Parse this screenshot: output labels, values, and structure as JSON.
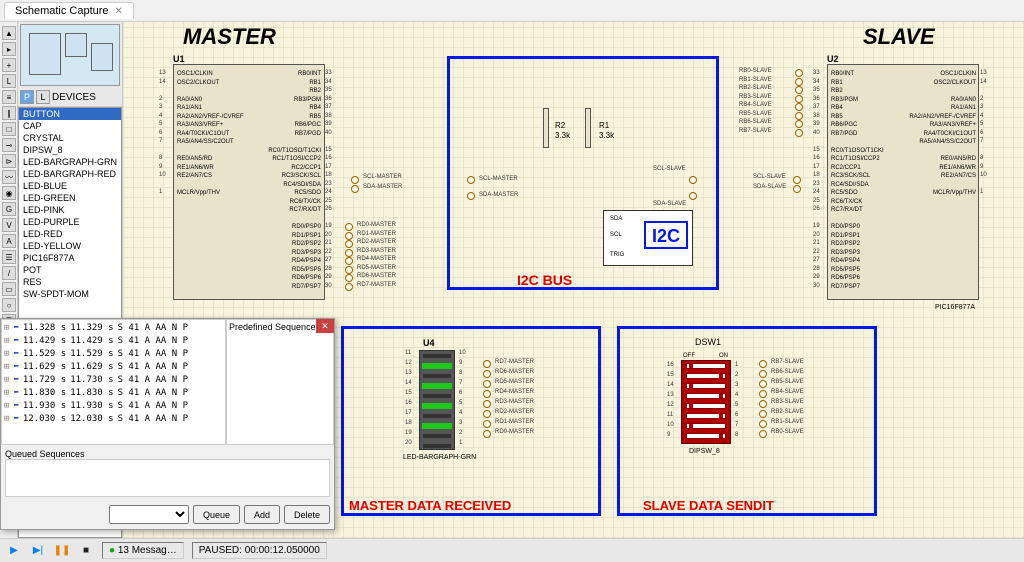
{
  "tab": {
    "title": "Schematic Capture",
    "close": "✕"
  },
  "devices": {
    "header": "DEVICES",
    "items": [
      "BUTTON",
      "CAP",
      "CRYSTAL",
      "DIPSW_8",
      "LED-BARGRAPH-GRN",
      "LED-BARGRAPH-RED",
      "LED-BLUE",
      "LED-GREEN",
      "LED-PINK",
      "LED-PURPLE",
      "LED-RED",
      "LED-YELLOW",
      "PIC16F877A",
      "POT",
      "RES",
      "SW-SPDT-MOM"
    ],
    "selected_index": 0
  },
  "titles": {
    "master": "MASTER",
    "slave": "SLAVE",
    "i2c_bus": "I2C BUS",
    "master_data": "MASTER DATA RECEIVED",
    "slave_data": "SLAVE DATA SENDIT"
  },
  "refs": {
    "u1": "U1",
    "u2": "U2",
    "u4": "U4",
    "dsw1": "DSW1",
    "r1": "R1",
    "r2": "R2",
    "r_val": "3.3k"
  },
  "i2c": {
    "label": "I2C",
    "sda": "SDA",
    "scl": "SCL",
    "trig": "TRIG"
  },
  "bus_labels": {
    "scl_master": "SCL-MASTER",
    "sda_master": "SDA-MASTER",
    "scl_slave": "SCL-SLAVE",
    "sda_slave": "SDA-SLAVE"
  },
  "u1_pins_left": [
    "OSC1/CLKIN",
    "OSC2/CLKOUT",
    "",
    "RA0/AN0",
    "RA1/AN1",
    "RA2/AN2/VREF-/CVREF",
    "RA3/AN3/VREF+",
    "RA4/T0CKI/C1OUT",
    "RA5/AN4/SS/C2OUT",
    "",
    "RE0/AN5/RD",
    "RE1/AN6/WR",
    "RE2/AN7/CS",
    "",
    "MCLR/Vpp/THV"
  ],
  "u1_nums_left": [
    "13",
    "14",
    "",
    "2",
    "3",
    "4",
    "5",
    "6",
    "7",
    "",
    "8",
    "9",
    "10",
    "",
    "1"
  ],
  "u1_pins_right": [
    "RB0/INT",
    "RB1",
    "RB2",
    "RB3/PGM",
    "RB4",
    "RB5",
    "RB6/PGC",
    "RB7/PGD",
    "",
    "RC0/T1OSO/T1CKI",
    "RC1/T1OSI/CCP2",
    "RC2/CCP1",
    "RC3/SCK/SCL",
    "RC4/SDI/SDA",
    "RC5/SDO",
    "RC6/TX/CK",
    "RC7/RX/DT",
    "",
    "RD0/PSP0",
    "RD1/PSP1",
    "RD2/PSP2",
    "RD3/PSP3",
    "RD4/PSP4",
    "RD5/PSP5",
    "RD6/PSP6",
    "RD7/PSP7"
  ],
  "u1_nums_right": [
    "33",
    "34",
    "35",
    "36",
    "37",
    "38",
    "39",
    "40",
    "",
    "15",
    "16",
    "17",
    "18",
    "23",
    "24",
    "25",
    "26",
    "",
    "19",
    "20",
    "21",
    "22",
    "27",
    "28",
    "29",
    "30"
  ],
  "u2_pins_left": [
    "RB0/INT",
    "RB1",
    "RB2",
    "RB3/PGM",
    "RB4",
    "RB5",
    "RB6/PGC",
    "RB7/PGD",
    "",
    "RC0/T1OSO/T1CKI",
    "RC1/T1OSI/CCP2",
    "RC2/CCP1",
    "RC3/SCK/SCL",
    "RC4/SDI/SDA",
    "RC5/SDO",
    "RC6/TX/CK",
    "RC7/RX/DT",
    "",
    "RD0/PSP0",
    "RD1/PSP1",
    "RD2/PSP2",
    "RD3/PSP3",
    "RD4/PSP4",
    "RD5/PSP5",
    "RD6/PSP6",
    "RD7/PSP7"
  ],
  "u2_nums_left": [
    "33",
    "34",
    "35",
    "36",
    "37",
    "38",
    "39",
    "40",
    "",
    "15",
    "16",
    "17",
    "18",
    "23",
    "24",
    "25",
    "26",
    "",
    "19",
    "20",
    "21",
    "22",
    "27",
    "28",
    "29",
    "30"
  ],
  "u2_pins_right": [
    "OSC1/CLKIN",
    "OSC2/CLKOUT",
    "",
    "RA0/AN0",
    "RA1/AN1",
    "RA2/AN2/VREF-/CVREF",
    "RA3/AN3/VREF+",
    "RA4/T0CKI/C1OUT",
    "RA5/AN4/SS/C2OUT",
    "",
    "RE0/AN5/RD",
    "RE1/AN6/WR",
    "RE2/AN7/CS",
    "",
    "MCLR/Vpp/THV"
  ],
  "u2_nums_right": [
    "13",
    "14",
    "",
    "2",
    "3",
    "4",
    "5",
    "6",
    "7",
    "",
    "8",
    "9",
    "10",
    "",
    "1"
  ],
  "u2_slave_probes": [
    "RB0-SLAVE",
    "RB1-SLAVE",
    "RB2-SLAVE",
    "RB3-SLAVE",
    "RB4-SLAVE",
    "RB5-SLAVE",
    "RB6-SLAVE",
    "RB7-SLAVE"
  ],
  "u1_master_probes": [
    "RD0-MASTER",
    "RD1-MASTER",
    "RD2-MASTER",
    "RD3-MASTER",
    "RD4-MASTER",
    "RD5-MASTER",
    "RD6-MASTER",
    "RD7-MASTER"
  ],
  "u4_nums_left": [
    "11",
    "12",
    "13",
    "14",
    "15",
    "16",
    "17",
    "18",
    "19",
    "20"
  ],
  "u4_nums_right": [
    "10",
    "9",
    "8",
    "7",
    "6",
    "5",
    "4",
    "3",
    "2",
    "1"
  ],
  "u4_right_probes": [
    "RD7-MASTER",
    "RD6-MASTER",
    "RD5-MASTER",
    "RD4-MASTER",
    "RD3-MASTER",
    "RD2-MASTER",
    "RD1-MASTER",
    "RD0-MASTER"
  ],
  "u4_caption": "LED-BARGRAPH-GRN",
  "dsw_caption": "DIPSW_8",
  "dsw_off": "OFF",
  "dsw_on": "ON",
  "dsw_nums_left": [
    "16",
    "15",
    "14",
    "13",
    "12",
    "11",
    "10",
    "9"
  ],
  "dsw_nums_right": [
    "1",
    "2",
    "3",
    "4",
    "5",
    "6",
    "7",
    "8"
  ],
  "dsw_probes": [
    "RB7-SLAVE",
    "RB6-SLAVE",
    "RB5-SLAVE",
    "RB4-SLAVE",
    "RB3-SLAVE",
    "RB2-SLAVE",
    "RB1-SLAVE",
    "RB0-SLAVE"
  ],
  "mcu": "PIC16F877A",
  "log": {
    "predefined": "Predefined Sequences",
    "queued": "Queued Sequences",
    "queue_btn": "Queue",
    "add_btn": "Add",
    "delete_btn": "Delete",
    "rows": [
      [
        "11.328",
        "11.329",
        "S 41 A  AA  N  P"
      ],
      [
        "11.429",
        "11.429",
        "S 41 A  AA  N  P"
      ],
      [
        "11.529",
        "11.529",
        "S 41 A  AA  N  P"
      ],
      [
        "11.629",
        "11.629",
        "S 41 A  AA  N  P"
      ],
      [
        "11.729",
        "11.730",
        "S 41 A  AA  N  P"
      ],
      [
        "11.830",
        "11.830",
        "S 41 A  AA  N  P"
      ],
      [
        "11.930",
        "11.930",
        "S 41 A  AA  N  P"
      ],
      [
        "12.030",
        "12.030",
        "S 41 A  AA  N  P"
      ]
    ]
  },
  "status": {
    "messages": "13 Messag…",
    "paused": "PAUSED: 00:00:12.050000"
  }
}
